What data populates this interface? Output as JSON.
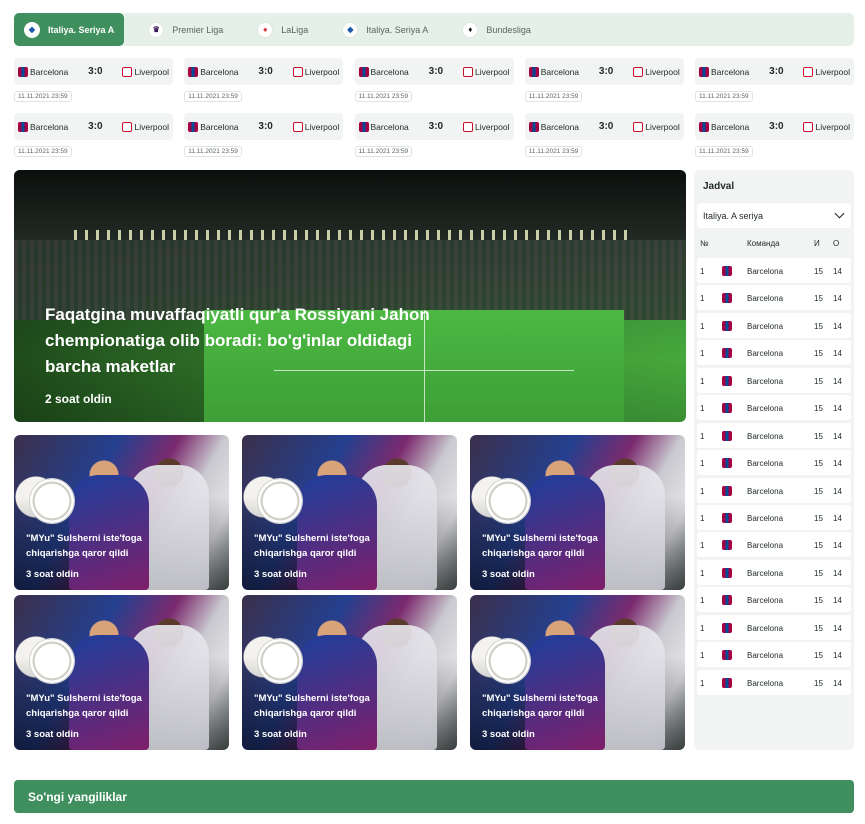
{
  "leagues": [
    {
      "label": "Italiya. Seriya A",
      "active": true
    },
    {
      "label": "Premier Liga",
      "active": false
    },
    {
      "label": "LaLiga",
      "active": false
    },
    {
      "label": "Italiya. Seriya A",
      "active": false
    },
    {
      "label": "Bundesliga",
      "active": false
    }
  ],
  "matches": [
    {
      "home": "Barcelona",
      "score": "3:0",
      "away": "Liverpool",
      "date": "11.11.2021 23:59"
    },
    {
      "home": "Barcelona",
      "score": "3:0",
      "away": "Liverpool",
      "date": "11.11.2021 23:59"
    },
    {
      "home": "Barcelona",
      "score": "3:0",
      "away": "Liverpool",
      "date": "11.11.2021 23:59"
    },
    {
      "home": "Barcelona",
      "score": "3:0",
      "away": "Liverpool",
      "date": "11.11.2021 23:59"
    },
    {
      "home": "Barcelona",
      "score": "3:0",
      "away": "Liverpool",
      "date": "11.11.2021 23:59"
    },
    {
      "home": "Barcelona",
      "score": "3:0",
      "away": "Liverpool",
      "date": "11.11.2021 23:59"
    },
    {
      "home": "Barcelona",
      "score": "3:0",
      "away": "Liverpool",
      "date": "11.11.2021 23:59"
    },
    {
      "home": "Barcelona",
      "score": "3:0",
      "away": "Liverpool",
      "date": "11.11.2021 23:59"
    },
    {
      "home": "Barcelona",
      "score": "3:0",
      "away": "Liverpool",
      "date": "11.11.2021 23:59"
    },
    {
      "home": "Barcelona",
      "score": "3:0",
      "away": "Liverpool",
      "date": "11.11.2021 23:59"
    }
  ],
  "hero": {
    "title": "Faqatgina muvaffaqiyatli qur'a Rossiyani Jahon chempionatiga olib boradi: bo'g'inlar oldidagi barcha maketlar",
    "time": "2 soat oldin"
  },
  "news": [
    {
      "title": "\"MYu\" Sulsherni iste'foga chiqarishga qaror qildi",
      "time": "3 soat oldin"
    },
    {
      "title": "\"MYu\" Sulsherni iste'foga chiqarishga qaror qildi",
      "time": "3 soat oldin"
    },
    {
      "title": "\"MYu\" Sulsherni iste'foga chiqarishga qaror qildi",
      "time": "3 soat oldin"
    },
    {
      "title": "\"MYu\" Sulsherni iste'foga chiqarishga qaror qildi",
      "time": "3 soat oldin"
    },
    {
      "title": "\"MYu\" Sulsherni iste'foga chiqarishga qaror qildi",
      "time": "3 soat oldin"
    },
    {
      "title": "\"MYu\" Sulsherni iste'foga chiqarishga qaror qildi",
      "time": "3 soat oldin"
    }
  ],
  "standings": {
    "title": "Jadval",
    "selected_league": "Italiya. A seriya",
    "columns": {
      "num": "№",
      "team": "Команда",
      "i": "И",
      "o": "О"
    },
    "rows": [
      {
        "num": "1",
        "team": "Barcelona",
        "i": "15",
        "o": "14"
      },
      {
        "num": "1",
        "team": "Barcelona",
        "i": "15",
        "o": "14"
      },
      {
        "num": "1",
        "team": "Barcelona",
        "i": "15",
        "o": "14"
      },
      {
        "num": "1",
        "team": "Barcelona",
        "i": "15",
        "o": "14"
      },
      {
        "num": "1",
        "team": "Barcelona",
        "i": "15",
        "o": "14"
      },
      {
        "num": "1",
        "team": "Barcelona",
        "i": "15",
        "o": "14"
      },
      {
        "num": "1",
        "team": "Barcelona",
        "i": "15",
        "o": "14"
      },
      {
        "num": "1",
        "team": "Barcelona",
        "i": "15",
        "o": "14"
      },
      {
        "num": "1",
        "team": "Barcelona",
        "i": "15",
        "o": "14"
      },
      {
        "num": "1",
        "team": "Barcelona",
        "i": "15",
        "o": "14"
      },
      {
        "num": "1",
        "team": "Barcelona",
        "i": "15",
        "o": "14"
      },
      {
        "num": "1",
        "team": "Barcelona",
        "i": "15",
        "o": "14"
      },
      {
        "num": "1",
        "team": "Barcelona",
        "i": "15",
        "o": "14"
      },
      {
        "num": "1",
        "team": "Barcelona",
        "i": "15",
        "o": "14"
      },
      {
        "num": "1",
        "team": "Barcelona",
        "i": "15",
        "o": "14"
      },
      {
        "num": "1",
        "team": "Barcelona",
        "i": "15",
        "o": "14"
      }
    ]
  },
  "latest": {
    "label": "So'ngi yangiliklar"
  },
  "colors": {
    "accent": "#3f8f5f",
    "tab_bg": "#e5f0e8",
    "panel_bg": "#f1f4f2"
  },
  "icons": {
    "league_logo": "league-logo-icon",
    "crest_home": "barcelona-crest-icon",
    "crest_away": "liverpool-crest-icon",
    "chevron": "chevron-down-icon"
  }
}
